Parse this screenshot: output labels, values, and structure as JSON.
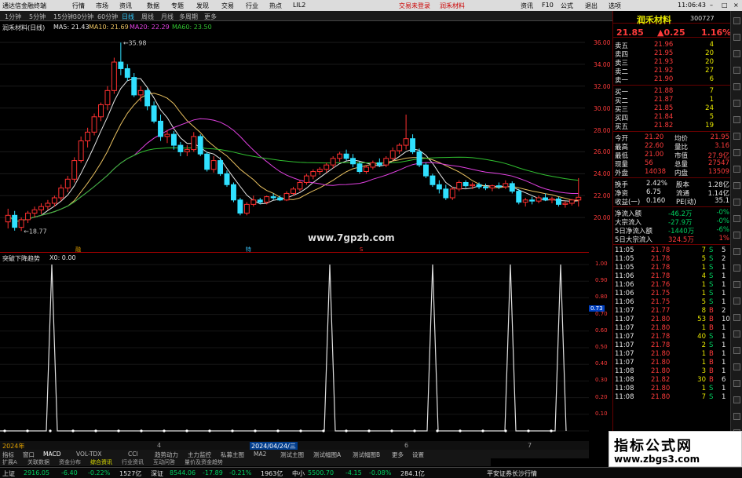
{
  "app": {
    "title": "通达信金融终端",
    "menu": [
      "行情",
      "市场",
      "资讯",
      "数据",
      "专题",
      "发现",
      "交易",
      "行业",
      "热点"
    ],
    "login": "LIL2",
    "trade_menu": [
      "交易未登录",
      "润禾材料"
    ],
    "right_menu": [
      "资讯",
      "F10",
      "公式",
      "退出",
      "选项"
    ],
    "clock": "11:06:43"
  },
  "toolbar": {
    "periods": [
      "1分钟",
      "5分钟",
      "15分钟",
      "30分钟",
      "60分钟",
      "日线",
      "周线",
      "月线",
      "多周期",
      "更多"
    ],
    "active_period": "日线"
  },
  "chart_info": {
    "name": "润禾材料(日线)",
    "ma5": "MA5: 21.43",
    "ma10": "MA10: 21.69",
    "ma20": "MA20: 22.29",
    "ma60": "MA60: 23.50"
  },
  "price_axis": [
    "36.00",
    "34.00",
    "32.00",
    "30.00",
    "28.00",
    "26.00",
    "24.00",
    "22.00",
    "20.00"
  ],
  "annotations": {
    "high": "35.98",
    "low": "18.77",
    "marker1": "融",
    "marker2": "特",
    "marker3": "S"
  },
  "watermark": "www.7gpzb.com",
  "sub_info": {
    "name": "突破下降趋势",
    "value": "X0: 0.00"
  },
  "sub_axis": [
    "1.00",
    "0.90",
    "0.80",
    "0.70",
    "0.60",
    "0.50",
    "0.40",
    "0.30",
    "0.20",
    "0.10"
  ],
  "sub_marker": "0.73",
  "date_bar": {
    "year": "2024年",
    "m4": "4",
    "date": "2024/04/24/三",
    "m6": "6",
    "m7": "7"
  },
  "bottom_tabs": [
    "指标",
    "窗口",
    "MACD",
    "VOL-TDX",
    "CCI",
    "趋势动力",
    "主力监控",
    "私募主图",
    "MA2",
    "测试主图",
    "测试幅图A",
    "测试幅图B",
    "更多",
    "设置"
  ],
  "bottom_tabs2": [
    "扩展A",
    "关联数据",
    "资金分布",
    "综合资讯",
    "行业资讯",
    "互动问答",
    "量价及资金趋势"
  ],
  "quote": {
    "name": "润禾材料",
    "code": "300727",
    "price": "21.85",
    "change": "▲0.25",
    "pct": "1.16%",
    "asks": [
      {
        "label": "卖五",
        "price": "21.96",
        "vol": "4"
      },
      {
        "label": "卖四",
        "price": "21.95",
        "vol": "20"
      },
      {
        "label": "卖三",
        "price": "21.93",
        "vol": "20"
      },
      {
        "label": "卖二",
        "price": "21.92",
        "vol": "27"
      },
      {
        "label": "卖一",
        "price": "21.90",
        "vol": "6"
      }
    ],
    "bids": [
      {
        "label": "买一",
        "price": "21.88",
        "vol": "7"
      },
      {
        "label": "买二",
        "price": "21.87",
        "vol": "1"
      },
      {
        "label": "买三",
        "price": "21.85",
        "vol": "24"
      },
      {
        "label": "买四",
        "price": "21.84",
        "vol": "5"
      },
      {
        "label": "买五",
        "price": "21.82",
        "vol": "19"
      }
    ],
    "stats": [
      {
        "k1": "今开",
        "v1": "21.20",
        "k2": "均价",
        "v2": "21.95"
      },
      {
        "k1": "最高",
        "v1": "22.60",
        "k2": "量比",
        "v2": "3.16"
      },
      {
        "k1": "最低",
        "v1": "21.00",
        "k2": "市值",
        "v2": "27.9亿"
      },
      {
        "k1": "现量",
        "v1": "56",
        "k2": "总量",
        "v2": "27547"
      },
      {
        "k1": "外盘",
        "v1": "14038",
        "k2": "内盘",
        "v2": "13509"
      }
    ],
    "stats2": [
      {
        "k1": "换手",
        "v1": "2.42%",
        "k2": "股本",
        "v2": "1.28亿"
      },
      {
        "k1": "净资",
        "v1": "6.75",
        "k2": "流通",
        "v2": "1.14亿"
      },
      {
        "k1": "收益(一)",
        "v1": "0.160",
        "k2": "PE(动)",
        "v2": "35.1"
      }
    ],
    "flows": [
      {
        "k": "净流入额",
        "v": "-46.2万",
        "p": "-0%"
      },
      {
        "k": "大宗流入",
        "v": "-27.9万",
        "p": "-0%"
      },
      {
        "k": "5日净流入额",
        "v": "-1440万",
        "p": "-6%"
      },
      {
        "k": "5日大宗流入",
        "v": "324.5万",
        "p": "1%"
      }
    ],
    "ticks": [
      {
        "t": "11:05",
        "p": "21.78",
        "v": "7",
        "d": "S",
        "n": "5"
      },
      {
        "t": "11:05",
        "p": "21.78",
        "v": "5",
        "d": "S",
        "n": "2"
      },
      {
        "t": "11:05",
        "p": "21.78",
        "v": "1",
        "d": "S",
        "n": "1"
      },
      {
        "t": "11:06",
        "p": "21.78",
        "v": "4",
        "d": "S",
        "n": "1"
      },
      {
        "t": "11:06",
        "p": "21.76",
        "v": "1",
        "d": "S",
        "n": "1"
      },
      {
        "t": "11:06",
        "p": "21.75",
        "v": "1",
        "d": "S",
        "n": "1"
      },
      {
        "t": "11:06",
        "p": "21.75",
        "v": "5",
        "d": "S",
        "n": "1"
      },
      {
        "t": "11:07",
        "p": "21.77",
        "v": "8",
        "d": "B",
        "n": "2"
      },
      {
        "t": "11:07",
        "p": "21.80",
        "v": "53",
        "d": "B",
        "n": "10"
      },
      {
        "t": "11:07",
        "p": "21.80",
        "v": "1",
        "d": "B",
        "n": "1"
      },
      {
        "t": "11:07",
        "p": "21.78",
        "v": "40",
        "d": "S",
        "n": "1"
      },
      {
        "t": "11:07",
        "p": "21.78",
        "v": "2",
        "d": "S",
        "n": "1"
      },
      {
        "t": "11:07",
        "p": "21.80",
        "v": "1",
        "d": "B",
        "n": "1"
      },
      {
        "t": "11:07",
        "p": "21.80",
        "v": "1",
        "d": "B",
        "n": "1"
      },
      {
        "t": "11:08",
        "p": "21.80",
        "v": "3",
        "d": "B",
        "n": "1"
      },
      {
        "t": "11:08",
        "p": "21.82",
        "v": "30",
        "d": "B",
        "n": "6"
      },
      {
        "t": "11:08",
        "p": "21.80",
        "v": "1",
        "d": "S",
        "n": "1"
      },
      {
        "t": "11:08",
        "p": "21.80",
        "v": "7",
        "d": "S",
        "n": "1"
      }
    ]
  },
  "status": {
    "sh_label": "上证",
    "sh": "2916.05",
    "sh_chg": "-6.40",
    "sh_pct": "-0.22%",
    "sh_amt": "1527亿",
    "sz_label": "深证",
    "sz": "8544.06",
    "sz_chg": "-17.89",
    "sz_pct": "-0.21%",
    "sz_amt": "1963亿",
    "zx_label": "中小",
    "zx": "5500.70",
    "zx_chg": "-4.15",
    "zx_pct": "-0.08%",
    "zx_amt": "284.1亿",
    "broker": "平安证券长沙行情"
  },
  "brand": {
    "line1": "指标公式网",
    "line2": "www.zbgs3.com"
  },
  "chart_data": {
    "type": "candlestick",
    "title": "润禾材料(日线)",
    "ylim": [
      18,
      36.5
    ],
    "candles": [
      [
        19.6,
        20.8,
        19.0,
        20.2
      ],
      [
        20.2,
        20.6,
        18.8,
        19.1
      ],
      [
        19.1,
        20.0,
        18.77,
        19.8
      ],
      [
        19.8,
        20.6,
        19.5,
        20.4
      ],
      [
        20.4,
        21.0,
        20.0,
        20.7
      ],
      [
        20.7,
        21.3,
        20.3,
        21.0
      ],
      [
        21.0,
        21.6,
        20.7,
        21.3
      ],
      [
        21.3,
        22.0,
        21.0,
        21.8
      ],
      [
        21.8,
        23.0,
        21.5,
        22.7
      ],
      [
        22.7,
        23.8,
        22.3,
        23.5
      ],
      [
        23.5,
        25.5,
        23.2,
        25.2
      ],
      [
        25.2,
        27.4,
        25.0,
        27.0
      ],
      [
        27.0,
        28.2,
        26.4,
        27.8
      ],
      [
        27.8,
        29.5,
        27.5,
        29.2
      ],
      [
        29.2,
        30.5,
        28.8,
        30.3
      ],
      [
        30.3,
        32.0,
        29.8,
        31.6
      ],
      [
        31.6,
        34.6,
        31.3,
        34.2
      ],
      [
        34.2,
        35.98,
        33.0,
        33.6
      ],
      [
        33.6,
        34.0,
        32.5,
        32.8
      ],
      [
        32.8,
        33.2,
        31.0,
        31.2
      ],
      [
        31.2,
        32.0,
        30.6,
        31.6
      ],
      [
        31.6,
        31.8,
        29.8,
        30.2
      ],
      [
        30.2,
        30.6,
        28.6,
        28.8
      ],
      [
        28.8,
        29.4,
        27.0,
        27.4
      ],
      [
        27.4,
        28.0,
        26.8,
        27.6
      ],
      [
        27.6,
        27.9,
        26.2,
        26.6
      ],
      [
        26.6,
        26.9,
        25.6,
        26.0
      ],
      [
        26.0,
        26.6,
        25.6,
        26.2
      ],
      [
        26.2,
        27.8,
        26.0,
        27.4
      ],
      [
        27.4,
        27.6,
        25.6,
        25.8
      ],
      [
        25.8,
        26.0,
        24.2,
        24.4
      ],
      [
        24.4,
        25.6,
        24.1,
        25.2
      ],
      [
        25.2,
        25.5,
        23.8,
        24.0
      ],
      [
        24.0,
        24.3,
        22.8,
        23.0
      ],
      [
        23.0,
        23.2,
        21.4,
        21.6
      ],
      [
        21.6,
        21.8,
        20.2,
        20.4
      ],
      [
        20.4,
        21.4,
        20.2,
        21.2
      ],
      [
        21.2,
        22.0,
        21.0,
        21.6
      ],
      [
        21.6,
        21.8,
        21.2,
        21.4
      ],
      [
        21.4,
        22.0,
        21.2,
        21.9
      ],
      [
        21.9,
        22.2,
        21.6,
        21.8
      ],
      [
        21.8,
        22.0,
        21.5,
        21.6
      ],
      [
        21.6,
        22.4,
        21.5,
        22.2
      ],
      [
        22.2,
        22.8,
        22.0,
        22.6
      ],
      [
        22.6,
        23.4,
        22.4,
        23.2
      ],
      [
        23.2,
        24.0,
        23.0,
        23.8
      ],
      [
        23.8,
        24.4,
        23.5,
        24.2
      ],
      [
        24.2,
        24.6,
        23.9,
        24.4
      ],
      [
        24.4,
        25.0,
        24.1,
        24.8
      ],
      [
        24.8,
        25.6,
        24.5,
        25.4
      ],
      [
        25.4,
        26.0,
        25.1,
        25.8
      ],
      [
        25.8,
        26.2,
        25.2,
        25.4
      ],
      [
        25.4,
        25.8,
        24.6,
        24.9
      ],
      [
        24.9,
        25.1,
        24.0,
        24.2
      ],
      [
        24.2,
        24.8,
        24.0,
        24.6
      ],
      [
        24.6,
        25.2,
        24.4,
        25.0
      ],
      [
        25.0,
        25.4,
        24.6,
        24.8
      ],
      [
        24.8,
        25.6,
        24.6,
        25.4
      ],
      [
        25.4,
        26.4,
        25.2,
        26.1
      ],
      [
        26.1,
        26.8,
        25.8,
        26.6
      ],
      [
        26.6,
        29.4,
        26.2,
        27.2
      ],
      [
        27.2,
        27.6,
        25.8,
        26.0
      ],
      [
        26.0,
        26.3,
        24.6,
        24.8
      ],
      [
        24.8,
        25.0,
        23.6,
        23.8
      ],
      [
        23.8,
        24.0,
        22.8,
        23.0
      ],
      [
        23.0,
        23.4,
        22.2,
        22.6
      ],
      [
        22.6,
        23.0,
        21.6,
        21.8
      ],
      [
        21.8,
        22.8,
        21.6,
        22.6
      ],
      [
        22.6,
        23.4,
        22.4,
        23.2
      ],
      [
        23.2,
        23.4,
        22.7,
        22.9
      ],
      [
        22.9,
        23.2,
        22.6,
        23.0
      ],
      [
        23.0,
        23.2,
        22.6,
        22.8
      ],
      [
        22.8,
        23.1,
        22.5,
        22.7
      ],
      [
        22.7,
        23.0,
        22.4,
        22.9
      ],
      [
        22.9,
        23.2,
        22.6,
        22.8
      ],
      [
        22.8,
        23.4,
        22.6,
        23.1
      ],
      [
        23.1,
        23.3,
        22.2,
        22.4
      ],
      [
        22.4,
        22.6,
        21.2,
        21.4
      ],
      [
        21.4,
        21.8,
        21.0,
        21.6
      ],
      [
        21.6,
        21.9,
        21.2,
        21.5
      ],
      [
        21.5,
        22.0,
        21.3,
        21.8
      ],
      [
        21.8,
        22.2,
        21.5,
        21.6
      ],
      [
        21.6,
        21.9,
        21.3,
        21.7
      ],
      [
        21.7,
        21.9,
        21.0,
        21.2
      ],
      [
        21.2,
        21.5,
        20.9,
        21.3
      ],
      [
        21.3,
        21.7,
        21.1,
        21.6
      ],
      [
        21.6,
        23.6,
        21.0,
        21.85
      ]
    ],
    "signal": {
      "name": "突破下降趋势",
      "x": [
        66,
        420,
        551,
        650,
        714
      ],
      "ylim": [
        0,
        1
      ]
    }
  }
}
